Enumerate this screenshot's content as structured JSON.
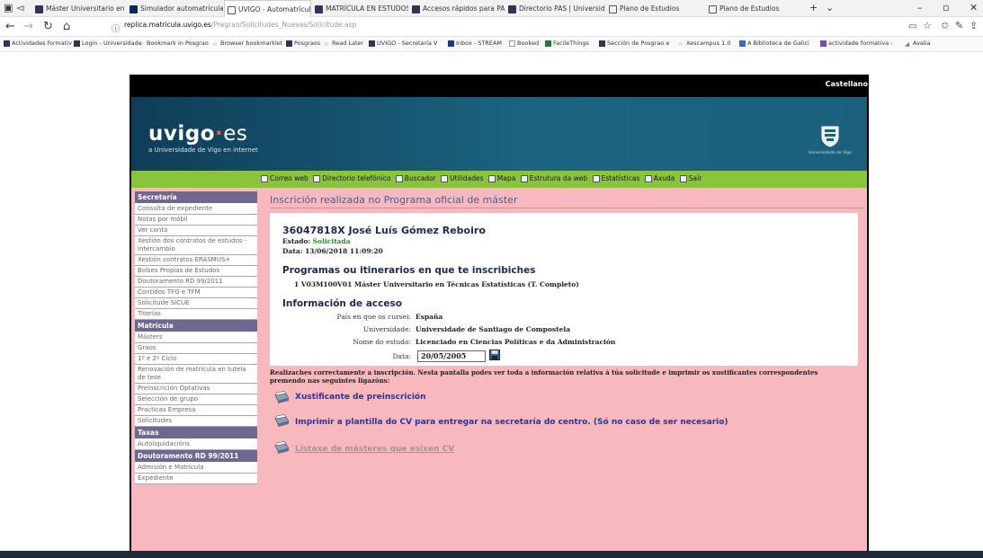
{
  "browser": {
    "tabs": [
      {
        "label": "Máster Universitario en Artes"
      },
      {
        "label": "Simulador automatrícula | S"
      },
      {
        "label": "UVIGO - Automatrícula"
      },
      {
        "label": "MATRÍCULA EN ESTUDOS E"
      },
      {
        "label": "Accesos rápidos para PAS |"
      },
      {
        "label": "Directorio PAS | Universidade"
      },
      {
        "label": "Plano de Estudios"
      },
      {
        "label": "Plano de Estudios"
      }
    ],
    "url_domain": "replica.matricula.uvigo.es",
    "url_path": "/Pregrao/Solicitudes_Nuevas/Solicitude.asp",
    "favorites": [
      "Actividades formativ",
      "Login - Universidade",
      "Bookmark in Posgrao",
      "Browser bookmarklet",
      "Posgraos",
      "Read Later",
      "UVIGO - Secretaría V",
      "Inbox - STREAM",
      "Booked",
      "FacileThings",
      "Sección de Posgrao e",
      "Xescampus 1.0",
      "A Biblioteca de Galici",
      "actividade formativa -",
      "Avalia"
    ],
    "icons": {
      "back": "back-arrow-icon",
      "forward": "forward-arrow-icon",
      "refresh": "refresh-icon",
      "home": "home-icon"
    }
  },
  "site": {
    "language": "Castellano",
    "logo_main": "uvigo",
    "logo_es": "es",
    "tagline": "a Universidade de Vigo en internet",
    "crest_label": "Universidade de Vigo",
    "topnav": [
      "Correo web",
      "Directorio telefónico",
      "Buscador",
      "Utilidades",
      "Mapa",
      "Estrutura da web",
      "Estatísticas",
      "Axuda",
      "Saír"
    ]
  },
  "sidebar": {
    "sections": [
      {
        "title": "Secretaría",
        "items": [
          "Consulta de expediente",
          "Notas por móbil",
          "Ver conta",
          "Xestión dos contratos de estudos - intercambio",
          "Xestión contratos ERASMUS+",
          "Bolses Propias de Estudos",
          "Doutoramento RD 99/2011",
          "Contidos TFG e TFM",
          "Solicitude SICUE",
          "Titorías"
        ]
      },
      {
        "title": "Matrícula",
        "items": [
          "Másters",
          "Graos",
          "1º e 2º Ciclo",
          "Renovación de matrícula en tutela de tese",
          "Preinscrición Optativas",
          "Selección de grupo",
          "Practicas Empresa",
          "Solicitudes"
        ]
      },
      {
        "title": "Taxas",
        "items": [
          "Autoliquidacións"
        ]
      },
      {
        "title": "Doutoramento RD 99/2011",
        "items": [
          "Admisión e Matrícula",
          "Expediente"
        ]
      }
    ]
  },
  "main": {
    "title": "Inscrición realizada no Programa oficial de máster",
    "person": "36047818X José Luís Gómez Reboiro",
    "estado_label": "Estado:",
    "estado_value": "Solicitada",
    "data_line": "Data: 13/06/2018 11:09:20",
    "programs_heading": "Programas ou itinerarios en que te inscribiches",
    "program_item": "1  V03M100V01 Máster Universitario en Técnicas Estatísticas (T. Completo)",
    "access_heading": "Información de acceso",
    "access_rows": [
      {
        "label": "País en que os cursei:",
        "value": "España"
      },
      {
        "label": "Universidade:",
        "value": "Universidade de Santiago de Compostela"
      },
      {
        "label": "Nome do estudo:",
        "value": "Licenciado en Ciencias Políticas e da Administración"
      }
    ],
    "date_label": "Data:",
    "date_value": "20/05/2005",
    "message": "Realizaches correctamente a inscripción. Nesta pantalla podes ver toda a información relativa á túa solicitude e imprimir os xustificantes correspondentes premendo nas seguintes ligazóns:",
    "links": [
      "Xustificante de preinscrición",
      "Imprimir a plantilla do CV para entregar na secretaría do centro. (Só no caso de ser necesario)",
      "Listaxe de másteres que esixen CV"
    ]
  },
  "colors": {
    "banner": "#1b6480",
    "green_nav": "#8ac43c",
    "pink_bg": "#f7b9be",
    "sidebar_header": "#6e6790",
    "link": "#1e36b4"
  }
}
